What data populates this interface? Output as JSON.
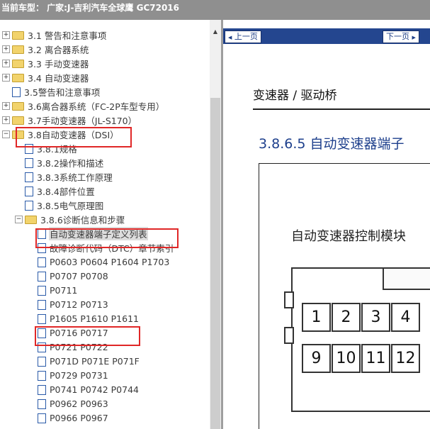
{
  "titlebar": {
    "text": "当前车型： 广家:J-吉利汽车全球鹰 GC72016"
  },
  "tree": {
    "items": [
      {
        "label": "3.1 警告和注意事项",
        "expander": "+",
        "icon": "folder"
      },
      {
        "label": "3.2 离合器系统",
        "expander": "+",
        "icon": "folder"
      },
      {
        "label": "3.3 手动变速器",
        "expander": "+",
        "icon": "folder"
      },
      {
        "label": "3.4 自动变速器",
        "expander": "+",
        "icon": "folder"
      },
      {
        "label": "3.5警告和注意事项",
        "icon": "page"
      },
      {
        "label": "3.6离合器系统（FC-2P车型专用）",
        "expander": "+",
        "icon": "folder"
      },
      {
        "label": "3.7手动变速器（JL-S170）",
        "expander": "+",
        "icon": "folder"
      },
      {
        "label": "3.8自动变速器（DSI）",
        "expander": "−",
        "icon": "folder"
      },
      {
        "label": "3.8.1规格",
        "icon": "page"
      },
      {
        "label": "3.8.2操作和描述",
        "icon": "page"
      },
      {
        "label": "3.8.3系统工作原理",
        "icon": "page"
      },
      {
        "label": "3.8.4部件位置",
        "icon": "page"
      },
      {
        "label": "3.8.5电气原理图",
        "icon": "page"
      },
      {
        "label": "3.8.6诊断信息和步骤",
        "expander": "−",
        "icon": "folder"
      },
      {
        "label": "自动变速器端子定义列表",
        "icon": "page"
      },
      {
        "label": "故障诊断代码（DTC）章节索引",
        "icon": "page"
      },
      {
        "label": "P0603 P0604 P1604 P1703",
        "icon": "page"
      },
      {
        "label": "P0707 P0708",
        "icon": "page"
      },
      {
        "label": "P0711",
        "icon": "page"
      },
      {
        "label": "P0712 P0713",
        "icon": "page"
      },
      {
        "label": "P1605 P1610 P1611",
        "icon": "page"
      },
      {
        "label": "P0716 P0717",
        "icon": "page"
      },
      {
        "label": "P0721 P0722",
        "icon": "page"
      },
      {
        "label": "P071D P071E P071F",
        "icon": "page"
      },
      {
        "label": "P0729 P0731",
        "icon": "page"
      },
      {
        "label": "P0741 P0742 P0744",
        "icon": "page"
      },
      {
        "label": "P0962 P0963",
        "icon": "page"
      },
      {
        "label": "P0966 P0967",
        "icon": "page"
      }
    ]
  },
  "nav": {
    "prev_label": "上一页",
    "next_label": "下一页"
  },
  "content": {
    "section_title": "变速器 / 驱动桥",
    "sub_title": "3.8.6.5  自动变速器端子",
    "diagram_title": "自动变速器控制模块",
    "pins_row1": [
      "1",
      "2",
      "3",
      "4"
    ],
    "pins_row2": [
      "9",
      "10",
      "11",
      "12"
    ]
  },
  "colors": {
    "highlight": "#e02727",
    "nav_bar": "#24468f",
    "heading": "#1d3f8c"
  }
}
